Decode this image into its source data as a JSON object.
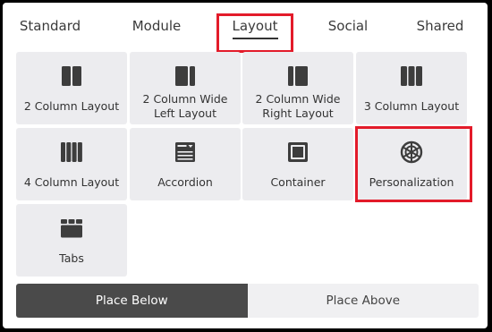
{
  "tabs": [
    {
      "label": "Standard"
    },
    {
      "label": "Module"
    },
    {
      "label": "Layout"
    },
    {
      "label": "Social"
    },
    {
      "label": "Shared"
    }
  ],
  "active_tab": "Layout",
  "tiles": [
    {
      "label": "2 Column Layout",
      "icon": "two-column-icon"
    },
    {
      "label": "2 Column Wide\nLeft Layout",
      "icon": "two-column-wide-left-icon"
    },
    {
      "label": "2 Column Wide\nRight Layout",
      "icon": "two-column-wide-right-icon"
    },
    {
      "label": "3 Column Layout",
      "icon": "three-column-icon"
    },
    {
      "label": "4 Column Layout",
      "icon": "four-column-icon"
    },
    {
      "label": "Accordion",
      "icon": "accordion-icon"
    },
    {
      "label": "Container",
      "icon": "container-icon"
    },
    {
      "label": "Personalization",
      "icon": "personalization-icon"
    },
    {
      "label": "Tabs",
      "icon": "tabs-icon"
    }
  ],
  "placement": {
    "below": "Place Below",
    "above": "Place Above",
    "selected": "below"
  },
  "colors": {
    "highlight": "#e31b2a",
    "icon": "#3d3d3d",
    "tile_bg": "#ececef",
    "selected_button": "#4a4a4a"
  }
}
